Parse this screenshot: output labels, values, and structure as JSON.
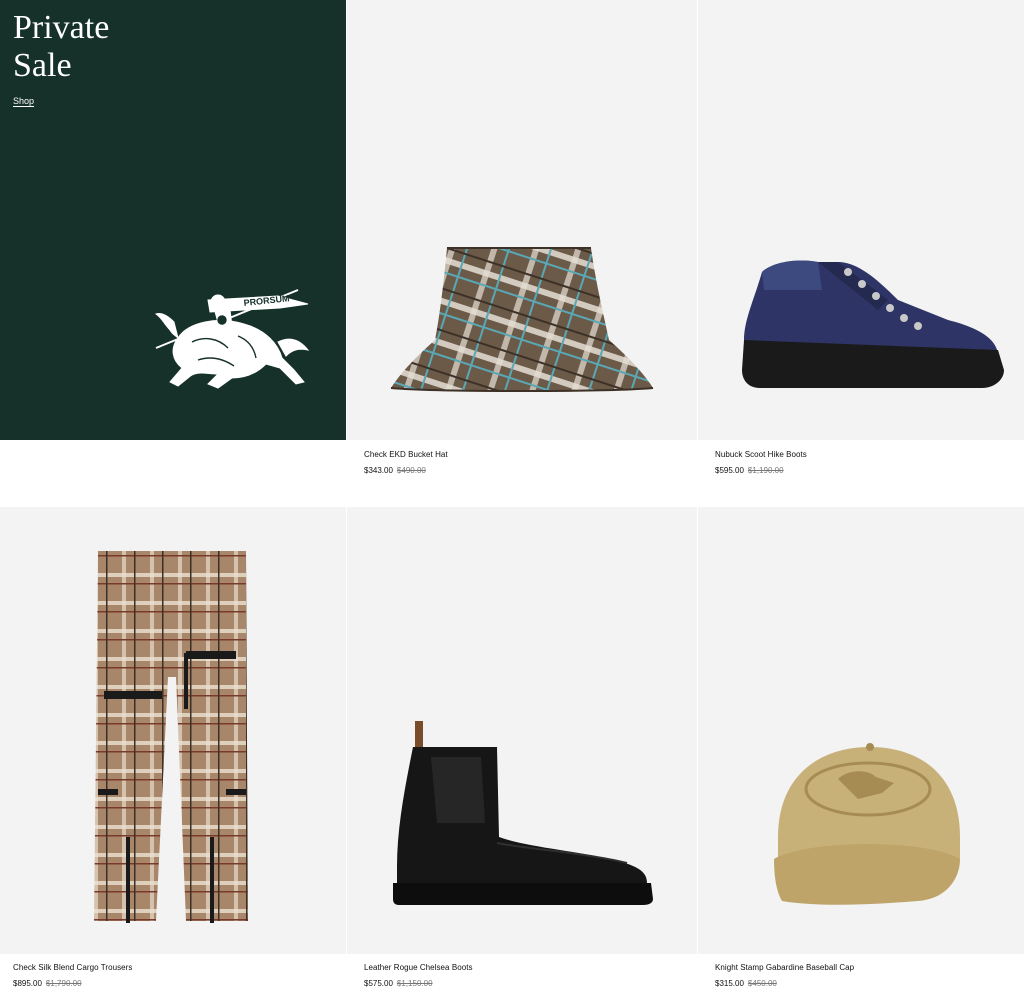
{
  "promo": {
    "title_line1": "Private",
    "title_line2": "Sale",
    "link": "Shop",
    "logo_icon": "knight-logo-icon",
    "logo_text": "PRORSUM",
    "background": "#16302a"
  },
  "products": [
    {
      "name": "Check EKD Bucket Hat",
      "price": "$343.00",
      "was": "$490.00",
      "icon": "bucket-hat-image"
    },
    {
      "name": "Nubuck Scoot Hike Boots",
      "price": "$595.00",
      "was": "$1,190.00",
      "icon": "hike-boots-image"
    },
    {
      "name": "Check Silk Blend Cargo Trousers",
      "price": "$895.00",
      "was": "$1,790.00",
      "icon": "cargo-trousers-image"
    },
    {
      "name": "Leather Rogue Chelsea Boots",
      "price": "$575.00",
      "was": "$1,150.00",
      "icon": "chelsea-boots-image"
    },
    {
      "name": "Knight Stamp Gabardine Baseball Cap",
      "price": "$315.00",
      "was": "$450.00",
      "icon": "baseball-cap-image"
    }
  ]
}
